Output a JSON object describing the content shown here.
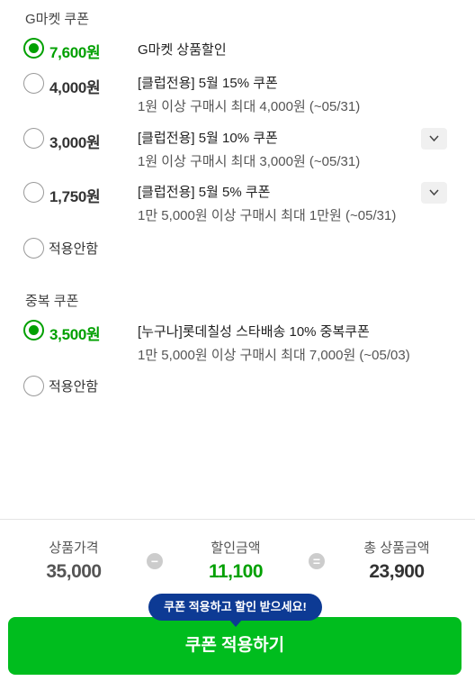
{
  "gmarket_section": {
    "title": "G마켓 쿠폰",
    "coupons": [
      {
        "amount": "7,600원",
        "title": "G마켓 상품할인",
        "desc": "",
        "checked": true
      },
      {
        "amount": "4,000원",
        "title": "[클럽전용] 5월 15% 쿠폰",
        "desc": "1원 이상 구매시 최대 4,000원 (~05/31)",
        "checked": false
      },
      {
        "amount": "3,000원",
        "title": "[클럽전용] 5월 10% 쿠폰",
        "desc": "1원 이상 구매시 최대 3,000원 (~05/31)",
        "checked": false
      },
      {
        "amount": "1,750원",
        "title": "[클럽전용] 5월 5% 쿠폰",
        "desc": "1만 5,000원 이상 구매시 최대 1만원 (~05/31)",
        "checked": false
      }
    ],
    "no_apply_label": "적용안함"
  },
  "dup_section": {
    "title": "중복 쿠폰",
    "coupons": [
      {
        "amount": "3,500원",
        "title": "[누구나]롯데칠성 스타배송 10% 중복쿠폰",
        "desc": "1만 5,000원 이상 구매시 최대 7,000원 (~05/03)",
        "checked": true
      }
    ],
    "no_apply_label": "적용안함"
  },
  "summary": {
    "price_label": "상품가격",
    "price_value": "35,000",
    "discount_label": "할인금액",
    "discount_value": "11,100",
    "total_label": "총 상품금액",
    "total_value": "23,900",
    "minus_symbol": "−",
    "equals_symbol": "="
  },
  "tooltip": "쿠폰 적용하고 할인 받으세요!",
  "apply_button": "쿠폰 적용하기",
  "colors": {
    "accent": "#00a000",
    "button": "#00bd1e",
    "tooltip": "#0d3a94"
  }
}
